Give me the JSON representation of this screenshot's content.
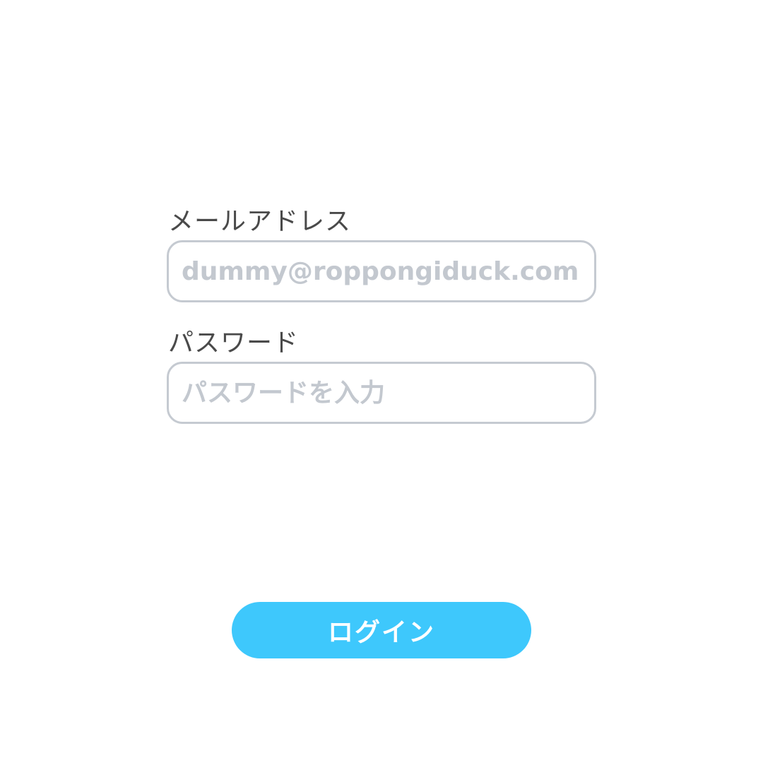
{
  "form": {
    "email": {
      "label": "メールアドレス",
      "value": "",
      "placeholder": "dummy@roppongiduck.com"
    },
    "password": {
      "label": "パスワード",
      "value": "",
      "placeholder": "パスワードを入力"
    },
    "submit_label": "ログイン"
  },
  "colors": {
    "accent": "#3ec8fc",
    "input_border": "#c5cad1",
    "placeholder": "#c3c8cf",
    "label_text": "#4a4a4a",
    "background": "#ffffff"
  }
}
